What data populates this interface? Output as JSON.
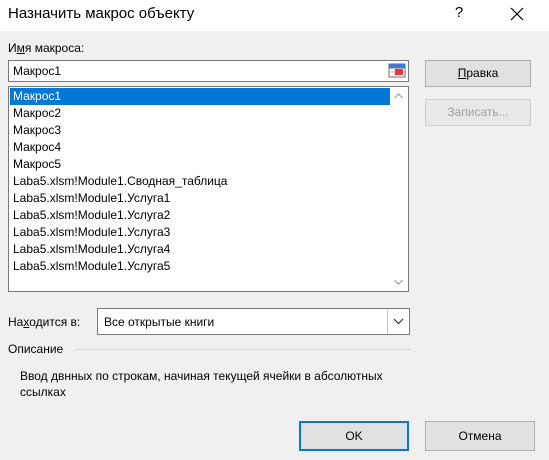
{
  "window": {
    "title": "Назначить макрос объекту",
    "help_glyph": "?",
    "close_glyph": "✕"
  },
  "macro_name": {
    "label_prefix": "И",
    "label_underlined": "м",
    "label_suffix": "я макроса:",
    "value": "Макрос1"
  },
  "macro_list": {
    "items": [
      "Макрос1",
      "Макрос2",
      "Макрос3",
      "Макрос4",
      "Макрос5",
      "Laba5.xlsm!Module1.Сводная_таблица",
      "Laba5.xlsm!Module1.Услуга1",
      "Laba5.xlsm!Module1.Услуга2",
      "Laba5.xlsm!Module1.Услуга3",
      "Laba5.xlsm!Module1.Услуга4",
      "Laba5.xlsm!Module1.Услуга5"
    ],
    "selected_index": 0
  },
  "buttons": {
    "edit_underlined": "П",
    "edit_rest": "равка",
    "record": "Записать...",
    "ok": "OK",
    "cancel": "Отмена"
  },
  "location": {
    "label_prefix": "На",
    "label_underlined": "х",
    "label_suffix": "одится в:",
    "value": "Все открытые книги"
  },
  "description": {
    "heading": "Описание",
    "text": "Ввод двнных по строкам, начиная текущей ячейки в абсолютных ссылках"
  },
  "colors": {
    "selection": "#0078d7",
    "default_button_border": "#0078d7"
  }
}
